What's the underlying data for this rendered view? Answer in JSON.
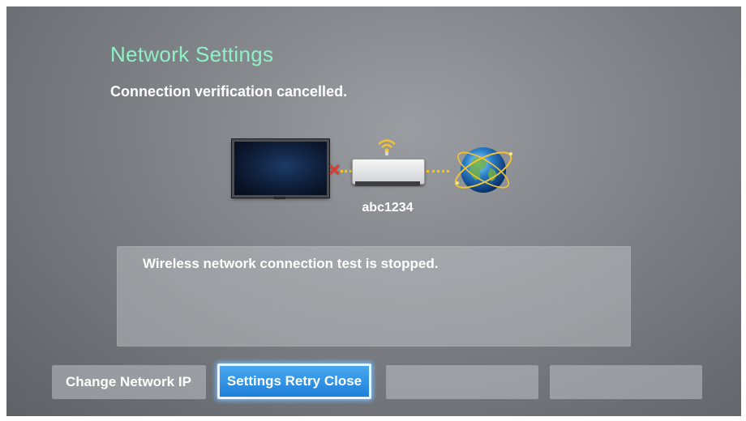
{
  "header": {
    "title": "Network Settings",
    "status": "Connection verification cancelled."
  },
  "diagram": {
    "ssid": "abc1234",
    "tv_link_state": "failed",
    "icons": [
      "tv-icon",
      "error-x-icon",
      "wifi-signal-icon",
      "router-icon",
      "globe-icon"
    ],
    "colors": {
      "error": "#e23a2e",
      "link": "#f3c431"
    }
  },
  "message": {
    "text": "Wireless network connection test is stopped."
  },
  "buttons": {
    "change_ip": "Change Network IP",
    "focused": "Settings Retry Close",
    "blank1": "",
    "blank2": ""
  },
  "colors": {
    "title": "#8ff2c6",
    "focus": "#1e7fd8"
  }
}
